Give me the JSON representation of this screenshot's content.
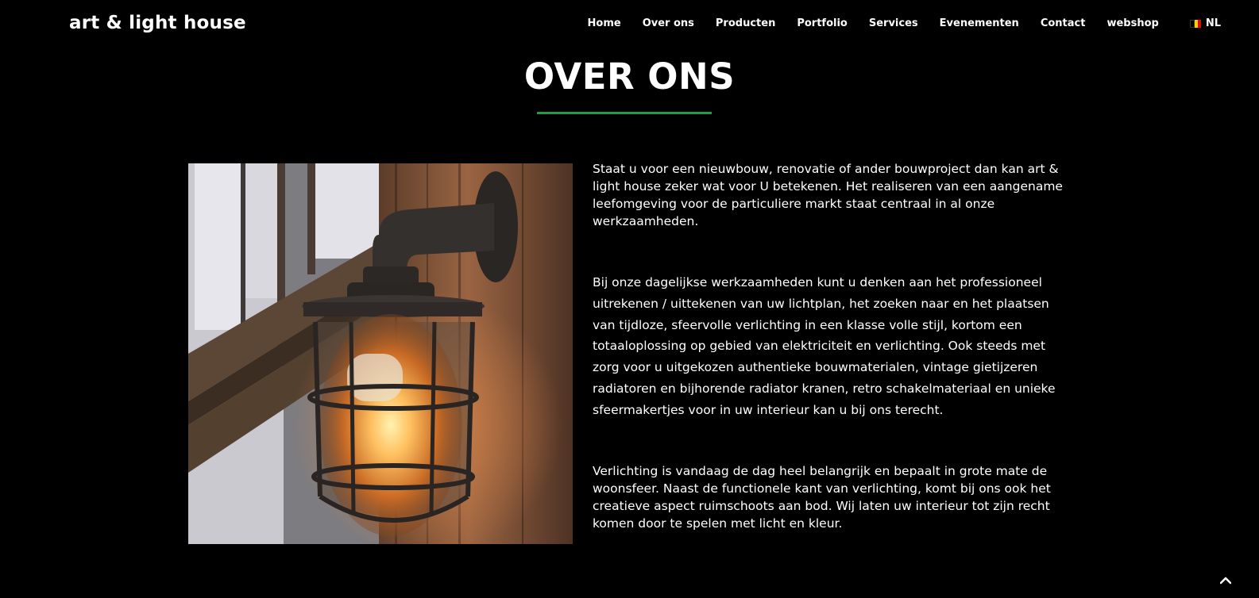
{
  "brand": "art & light house",
  "nav": {
    "items": [
      "Home",
      "Over ons",
      "Producten",
      "Portfolio",
      "Services",
      "Evenementen",
      "Contact",
      "webshop"
    ],
    "language": "NL"
  },
  "main": {
    "title": "OVER ONS",
    "paragraphs": [
      "Staat u voor een nieuwbouw, renovatie of ander bouwproject dan kan art & light house zeker wat voor U betekenen. Het realiseren van een aangename leefomgeving voor de particuliere markt staat centraal in al onze werkzaamheden.",
      "Bij onze dagelijkse werkzaamheden kunt u denken aan het professioneel uitrekenen / uittekenen van uw lichtplan, het zoeken naar en het plaatsen van tijdloze, sfeervolle verlichting in een klasse volle stijl, kortom een totaaloplossing op gebied van elektriciteit en verlichting. Ook steeds met zorg voor u uitgekozen authentieke bouwmaterialen, vintage gietijzeren radiatoren en bijhorende radiator kranen, retro schakelmateriaal en unieke sfeermakertjes voor in uw interieur kan u bij ons terecht.",
      "Verlichting is vandaag de dag heel belangrijk en bepaalt in grote mate de woonsfeer. Naast de functionele kant van verlichting, komt bij ons ook het creatieve aspect ruimschoots aan bod. Wij laten uw interieur tot zijn recht komen door te spelen met licht en kleur."
    ]
  },
  "icons": {
    "flag": "belgium-flag-icon",
    "scroll_top": "chevron-up-icon"
  },
  "colors": {
    "background": "#000000",
    "accent": "#1f9d45",
    "text": "#ffffff"
  }
}
